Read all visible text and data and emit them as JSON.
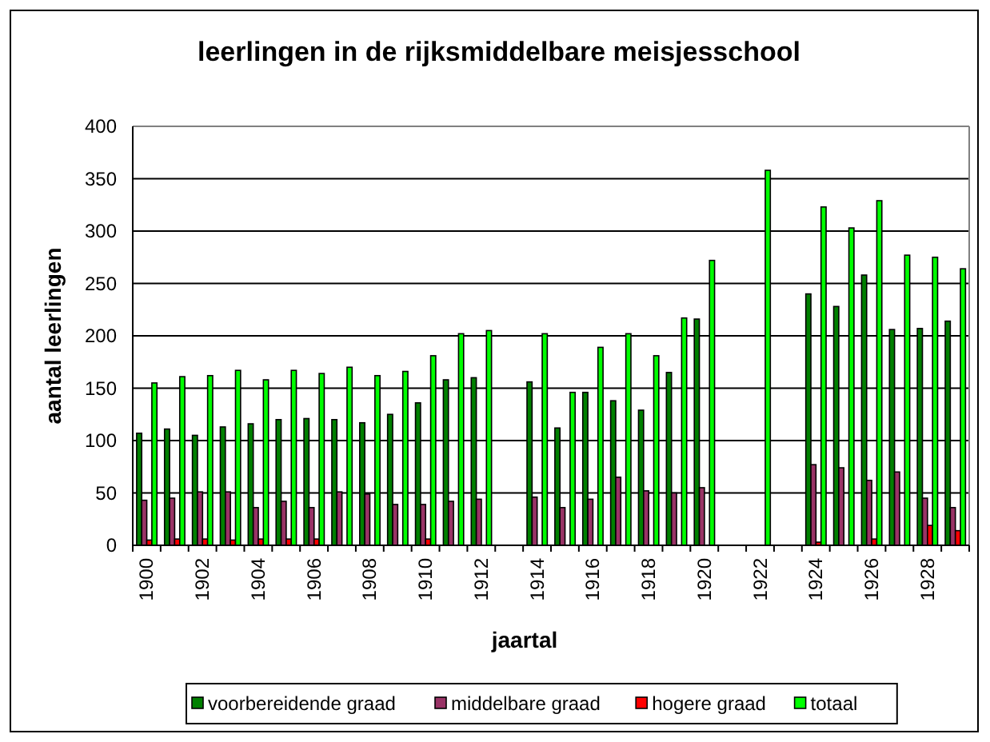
{
  "chart": {
    "chart_data": {
      "type": "bar",
      "title": "leerlingen in de rijksmiddelbare meisjesschool",
      "xlabel": "jaartal",
      "ylabel": "aantal leerlingen",
      "x": [
        1900,
        1901,
        1902,
        1903,
        1904,
        1905,
        1906,
        1907,
        1908,
        1909,
        1910,
        1911,
        1912,
        1913,
        1914,
        1915,
        1916,
        1917,
        1918,
        1919,
        1920,
        1921,
        1922,
        1923,
        1924,
        1925,
        1926,
        1927,
        1928,
        1929
      ],
      "xticks": [
        1900,
        1902,
        1904,
        1906,
        1908,
        1910,
        1912,
        1914,
        1916,
        1918,
        1920,
        1922,
        1924,
        1926,
        1928
      ],
      "grid": "y",
      "legend": true,
      "xlim": [
        1899.5,
        1929.5
      ],
      "ylim": [
        0,
        400
      ],
      "yticks": [
        0,
        50,
        100,
        150,
        200,
        250,
        300,
        350,
        400
      ],
      "series": [
        {
          "name": "voorbereidende graad",
          "color": "#008000",
          "values": [
            107,
            111,
            105,
            113,
            116,
            120,
            121,
            120,
            117,
            125,
            136,
            158,
            160,
            null,
            156,
            112,
            146,
            138,
            129,
            165,
            216,
            null,
            null,
            null,
            240,
            228,
            258,
            206,
            207,
            214
          ]
        },
        {
          "name": "middelbare graad",
          "color": "#993366",
          "values": [
            43,
            45,
            51,
            51,
            36,
            42,
            36,
            51,
            49,
            39,
            39,
            42,
            44,
            null,
            46,
            36,
            44,
            65,
            52,
            50,
            55,
            null,
            null,
            null,
            77,
            74,
            62,
            70,
            45,
            36
          ]
        },
        {
          "name": "hogere graad",
          "color": "#ff0000",
          "values": [
            5,
            6,
            6,
            5,
            6,
            6,
            6,
            null,
            null,
            null,
            6,
            null,
            null,
            null,
            null,
            null,
            null,
            null,
            null,
            null,
            null,
            null,
            null,
            null,
            3,
            null,
            6,
            null,
            19,
            14
          ]
        },
        {
          "name": "totaal",
          "color": "#00ff00",
          "values": [
            155,
            161,
            162,
            167,
            158,
            167,
            164,
            170,
            162,
            166,
            181,
            202,
            205,
            null,
            202,
            146,
            189,
            202,
            181,
            217,
            272,
            null,
            358,
            null,
            323,
            303,
            329,
            277,
            275,
            264
          ]
        }
      ]
    }
  }
}
